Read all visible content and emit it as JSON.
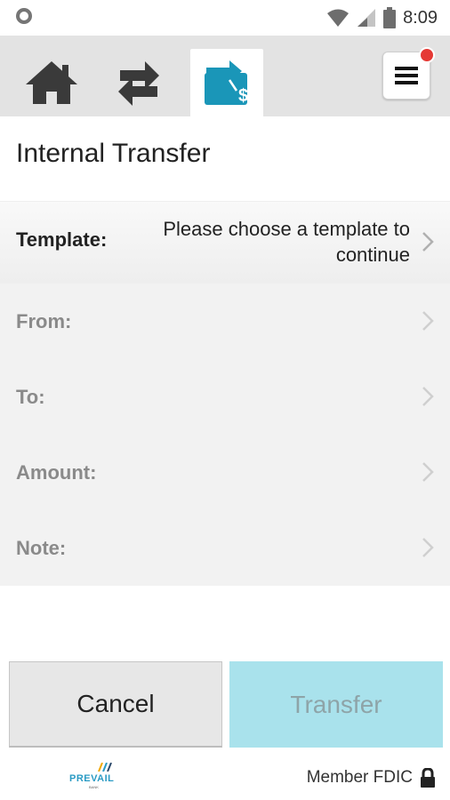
{
  "status_bar": {
    "time": "8:09"
  },
  "nav": {
    "tabs": [
      {
        "name": "home",
        "icon": "home-icon"
      },
      {
        "name": "transfers",
        "icon": "swap-arrows-icon"
      },
      {
        "name": "internal-transfer",
        "icon": "transfer-money-icon",
        "active": true
      }
    ],
    "menu_icon": "menu-icon",
    "menu_has_notification": true
  },
  "page": {
    "title": "Internal Transfer"
  },
  "template": {
    "label": "Template:",
    "value": "Please choose a template to continue"
  },
  "fields": [
    {
      "label": "From:"
    },
    {
      "label": "To:"
    },
    {
      "label": "Amount:"
    },
    {
      "label": "Note:"
    }
  ],
  "buttons": {
    "cancel": "Cancel",
    "transfer": "Transfer"
  },
  "footer": {
    "logo_text": "PREVAIL",
    "logo_sub": "BANK",
    "member": "Member FDIC"
  },
  "colors": {
    "accent": "#1a96b8",
    "transfer_button_bg": "#a9e2ec",
    "badge": "#e53935"
  }
}
